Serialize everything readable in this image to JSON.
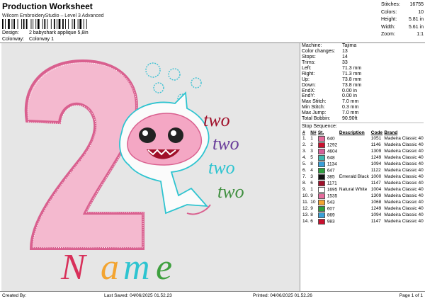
{
  "header": {
    "title": "Production Worksheet",
    "subtitle": "Wilcom EmbroideryStudio – Level 3 Advanced",
    "design_label": "Design:",
    "design_value": "2 babyshark applique 5,8in",
    "colorway_label": "Colorway:",
    "colorway_value": "Colorway 1"
  },
  "top_stats": [
    {
      "label": "Stitches:",
      "value": "16755"
    },
    {
      "label": "Colors:",
      "value": "10"
    },
    {
      "label": "Height:",
      "value": "5.81 in"
    },
    {
      "label": "Width:",
      "value": "5.61 in"
    },
    {
      "label": "Zoom:",
      "value": "1:1"
    }
  ],
  "machine": [
    {
      "label": "Machine:",
      "value": "Tajima"
    },
    {
      "label": "Color changes:",
      "value": "13"
    },
    {
      "label": "Stops:",
      "value": "14"
    },
    {
      "label": "Trims:",
      "value": "33"
    },
    {
      "label": "Left:",
      "value": "71.3 mm"
    },
    {
      "label": "Right:",
      "value": "71.3 mm"
    },
    {
      "label": "Up:",
      "value": "73.8 mm"
    },
    {
      "label": "Down:",
      "value": "73.8 mm"
    },
    {
      "label": "EndX:",
      "value": "0.00 in"
    },
    {
      "label": "EndY:",
      "value": "0.00 in"
    },
    {
      "label": "Max Stitch:",
      "value": "7.0 mm"
    },
    {
      "label": "Min Stitch:",
      "value": "0.3 mm"
    },
    {
      "label": "Max Jump:",
      "value": "7.0 mm"
    },
    {
      "label": "Total Bobbin:",
      "value": "90.90ft"
    }
  ],
  "stop_sequence": {
    "title": "Stop Sequence:",
    "headers": [
      "#",
      "N#",
      "St.",
      "Description",
      "Code",
      "Brand"
    ],
    "rows": [
      {
        "num": "1.",
        "n": "1",
        "color": "#e56b9c",
        "st": "640",
        "desc": "",
        "code": "1051",
        "brand": "Madeira Classic 40"
      },
      {
        "num": "2.",
        "n": "2",
        "color": "#c8102e",
        "st": "1292",
        "desc": "",
        "code": "1146",
        "brand": "Madeira Classic 40"
      },
      {
        "num": "3.",
        "n": "3",
        "color": "#d8609a",
        "st": "4604",
        "desc": "",
        "code": "1309",
        "brand": "Madeira Classic 40"
      },
      {
        "num": "4.",
        "n": "5",
        "color": "#3fb8b0",
        "st": "648",
        "desc": "",
        "code": "1249",
        "brand": "Madeira Classic 40"
      },
      {
        "num": "5.",
        "n": "8",
        "color": "#3aa0d8",
        "st": "1134",
        "desc": "",
        "code": "1094",
        "brand": "Madeira Classic 40"
      },
      {
        "num": "6.",
        "n": "4",
        "color": "#2e9e3e",
        "st": "647",
        "desc": "",
        "code": "1122",
        "brand": "Madeira Classic 40"
      },
      {
        "num": "7.",
        "n": "3",
        "color": "#111111",
        "st": "385",
        "desc": "Emerald Black",
        "code": "1000",
        "brand": "Madeira Classic 40"
      },
      {
        "num": "8.",
        "n": "6",
        "color": "#a0102a",
        "st": "1171",
        "desc": "",
        "code": "1147",
        "brand": "Madeira Classic 40"
      },
      {
        "num": "9.",
        "n": "1",
        "color": "#ffffff",
        "st": "1695",
        "desc": "Natural White",
        "code": "1004",
        "brand": "Madeira Classic 40"
      },
      {
        "num": "10.",
        "n": "9",
        "color": "#e56b9c",
        "st": "1535",
        "desc": "",
        "code": "1309",
        "brand": "Madeira Classic 40"
      },
      {
        "num": "11.",
        "n": "10",
        "color": "#f3a431",
        "st": "543",
        "desc": "",
        "code": "1068",
        "brand": "Madeira Classic 40"
      },
      {
        "num": "12.",
        "n": "9",
        "color": "#2e9e3e",
        "st": "607",
        "desc": "",
        "code": "1249",
        "brand": "Madeira Classic 40"
      },
      {
        "num": "13.",
        "n": "8",
        "color": "#3aa0d8",
        "st": "869",
        "desc": "",
        "code": "1094",
        "brand": "Madeira Classic 40"
      },
      {
        "num": "14.",
        "n": "6",
        "color": "#c8102e",
        "st": "983",
        "desc": "",
        "code": "1147",
        "brand": "Madeira Classic 40"
      }
    ]
  },
  "design": {
    "number": "2",
    "words": [
      "two",
      "two",
      "two",
      "two"
    ],
    "word_colors": [
      "#a0102a",
      "#6a3d9a",
      "#2ec4d0",
      "#3f8f3f"
    ],
    "name_letters": [
      "N",
      "a",
      "m",
      "e"
    ],
    "name_colors": [
      "#d8305a",
      "#f3a431",
      "#2ec4d0",
      "#3fa03f"
    ]
  },
  "footer": {
    "created_by": "Created By:",
    "last_saved": "Last Saved: 04/06/2025 01.52.23",
    "printed": "Printed: 04/06/2025 01.52.26",
    "page": "Page 1 of 1"
  }
}
